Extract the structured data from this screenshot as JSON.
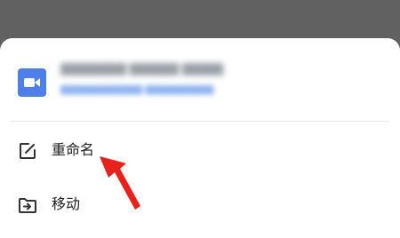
{
  "file": {
    "icon": "video-camera-icon",
    "name_blurred": "████████ ██████ █████",
    "meta_blurred": "████████████ ██████████",
    "icon_color": "#4f7fe8"
  },
  "menu": {
    "items": [
      {
        "label": "重命名",
        "icon": "rename-edit-icon"
      },
      {
        "label": "移动",
        "icon": "move-folder-icon"
      }
    ]
  },
  "annotation": {
    "arrow_color": "#e8211d"
  }
}
